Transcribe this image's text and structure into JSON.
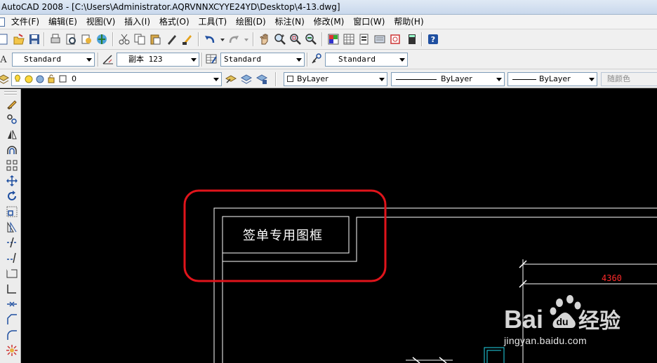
{
  "window": {
    "title": "AutoCAD 2008 - [C:\\Users\\Administrator.AQRVNNXCYYE24YD\\Desktop\\4-13.dwg]"
  },
  "menu": [
    "文件(F)",
    "编辑(E)",
    "视图(V)",
    "插入(I)",
    "格式(O)",
    "工具(T)",
    "绘图(D)",
    "标注(N)",
    "修改(M)",
    "窗口(W)",
    "帮助(H)"
  ],
  "styles": {
    "text_style": "Standard",
    "dim_style": "副本 123",
    "table_style": "Standard",
    "multileader_style": "Standard"
  },
  "layers": {
    "current_layer": "0",
    "color": "ByLayer",
    "linetype": "ByLayer",
    "lineweight": "ByLayer",
    "plot_style": "随颜色"
  },
  "drawing": {
    "frame_label": "签单专用图框",
    "dimension_value": "4360"
  },
  "watermark": {
    "brand_latin": "Bai",
    "brand_cn": "经验",
    "url": "jingyan.baidu.com"
  },
  "colors": {
    "canvas": "#000000",
    "annotation_circle": "#e0141b",
    "dimension_text": "#ff2a2a"
  },
  "icons": {
    "standard_toolbar": [
      "new-icon",
      "open-icon",
      "save-icon",
      "plot-icon",
      "plot-preview-icon",
      "publish-icon",
      "3d-dwf-icon",
      "cut-icon",
      "copy-icon",
      "paste-icon",
      "match-properties-icon",
      "block-editor-icon",
      "undo-icon",
      "redo-icon",
      "pan-icon",
      "zoom-realtime-icon",
      "zoom-window-icon",
      "zoom-previous-icon",
      "properties-icon",
      "design-center-icon",
      "tool-palettes-icon",
      "sheet-set-icon",
      "markup-icon",
      "quickcalc-icon",
      "help-icon"
    ],
    "modify_palette": [
      "erase-icon",
      "copy-object-icon",
      "mirror-icon",
      "offset-icon",
      "array-icon",
      "move-icon",
      "rotate-icon",
      "scale-icon",
      "stretch-icon",
      "trim-icon",
      "extend-icon",
      "break-at-point-icon",
      "break-icon",
      "join-icon",
      "chamfer-icon",
      "fillet-icon",
      "explode-icon"
    ]
  }
}
